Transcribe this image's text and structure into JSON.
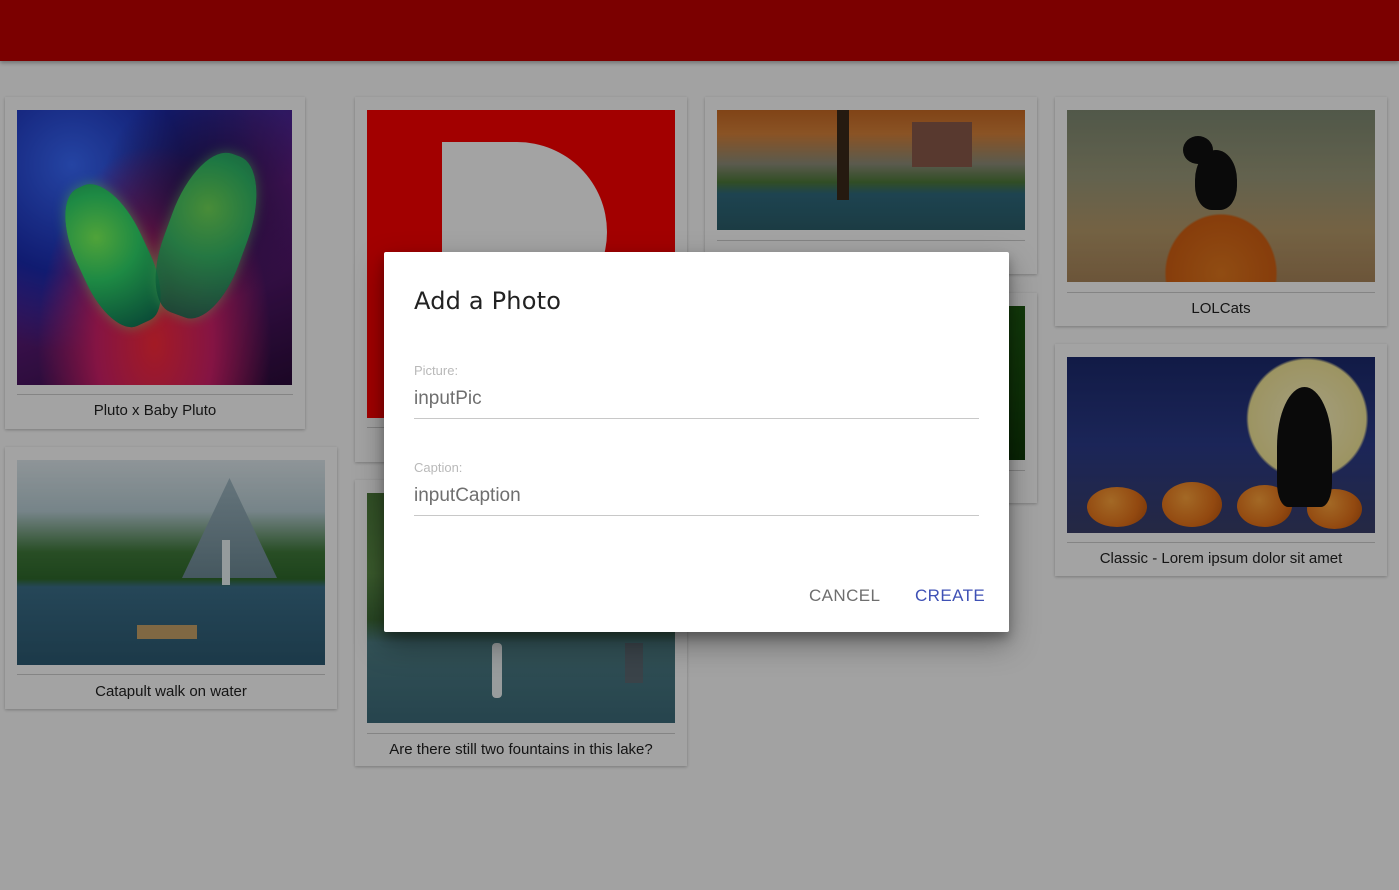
{
  "colors": {
    "app_bar": "#c10000",
    "primary_button": "#3f51b5",
    "scrim": "rgba(0,0,0,0.36)"
  },
  "photos": [
    {
      "caption": "Pluto x Baby Pluto",
      "icon": "album-art-image"
    },
    {
      "caption": "Catapult walk on water",
      "icon": "chapel-lake-image"
    },
    {
      "caption": "",
      "icon": "logo-d-image"
    },
    {
      "caption": "Are there still two fountains in this lake?",
      "icon": "fountain-lake-image"
    },
    {
      "caption": "",
      "icon": "campus-autumn-image"
    },
    {
      "caption": "",
      "icon": "dark-green-image"
    },
    {
      "caption": "LOLCats",
      "icon": "black-cat-pumpkin-image"
    },
    {
      "caption": "Classic - Lorem ipsum dolor sit amet",
      "icon": "peanuts-halloween-image"
    }
  ],
  "dialog": {
    "title": "Add a Photo",
    "picture_label": "Picture:",
    "picture_value": "inputPic",
    "caption_label": "Caption:",
    "caption_value": "inputCaption",
    "cancel_label": "CANCEL",
    "create_label": "CREATE"
  }
}
